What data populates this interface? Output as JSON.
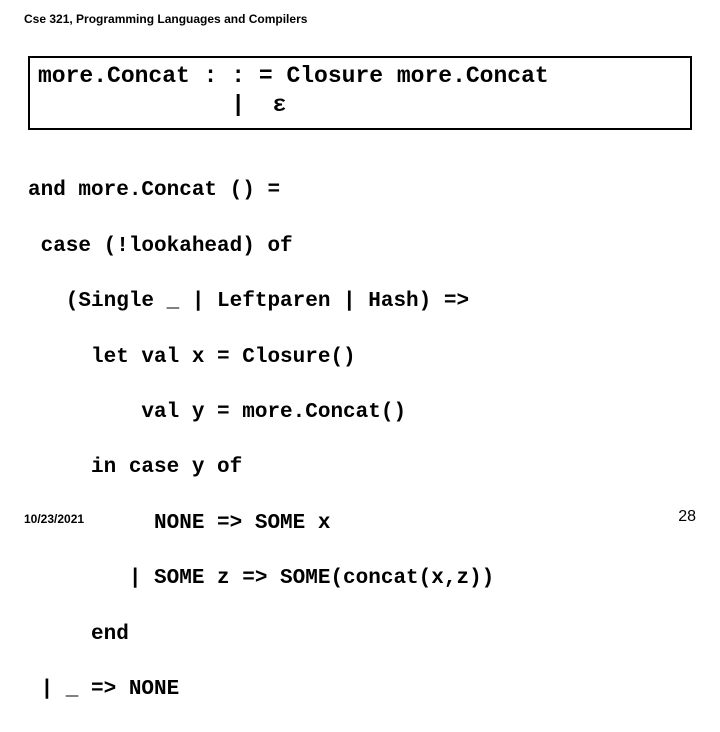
{
  "header": {
    "course": "Cse 321, Programming Languages and Compilers"
  },
  "grammar": {
    "line1": "more.Concat : : = Closure more.Concat",
    "line2": "              |  ε"
  },
  "code": {
    "l1": "and more.Concat () =",
    "l2": " case (!lookahead) of",
    "l3": "   (Single _ | Leftparen | Hash) =>",
    "l4": "     let val x = Closure()",
    "l5": "         val y = more.Concat()",
    "l6": "     in case y of",
    "l7": "          NONE => SOME x",
    "l8": "        | SOME z => SOME(concat(x,z))",
    "l9": "     end",
    "l10": " | _ => NONE"
  },
  "footer": {
    "date": "10/23/2021",
    "page": "28"
  }
}
